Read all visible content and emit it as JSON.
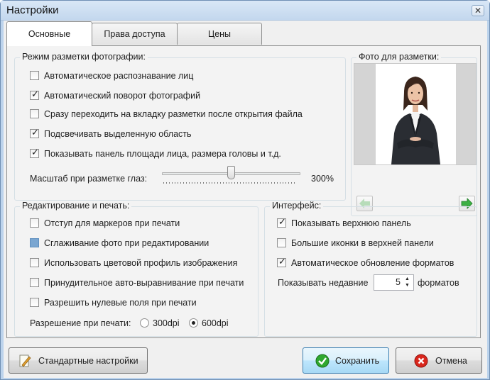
{
  "window": {
    "title": "Настройки",
    "close_label": "✕"
  },
  "tabs": [
    {
      "label": "Основные"
    },
    {
      "label": "Права доступа"
    },
    {
      "label": "Цены"
    }
  ],
  "markup_mode": {
    "title": "Режим разметки фотографии:",
    "options": [
      {
        "label": "Автоматическое распознавание лиц",
        "checked": false
      },
      {
        "label": "Автоматический поворот фотографий",
        "checked": true
      },
      {
        "label": "Сразу переходить на вкладку разметки после открытия файла",
        "checked": false
      },
      {
        "label": "Подсвечивать выделенную область",
        "checked": true
      },
      {
        "label": "Показывать панель площади лица, размера головы и т.д.",
        "checked": true
      }
    ],
    "eye_scale_label": "Масштаб при разметке глаз:",
    "eye_scale_value": "300%",
    "eye_scale_fraction": 0.5
  },
  "photo": {
    "title": "Фото для разметки:",
    "prev_icon": "arrow-left-icon",
    "next_icon": "arrow-right-icon"
  },
  "editing": {
    "title": "Редактирование и печать:",
    "options": [
      {
        "label": "Отступ для маркеров при печати",
        "checked": false
      },
      {
        "label": "Сглаживание фото при редактировании",
        "checked": "partial"
      },
      {
        "label": "Использовать цветовой профиль изображения",
        "checked": false
      },
      {
        "label": "Принудительное авто-выравнивание при печати",
        "checked": false
      },
      {
        "label": "Разрешить нулевые поля при печати",
        "checked": false
      }
    ],
    "resolution_label": "Разрешение при печати:",
    "resolution_options": [
      {
        "label": "300dpi",
        "selected": false
      },
      {
        "label": "600dpi",
        "selected": true
      }
    ]
  },
  "interface": {
    "title": "Интерфейс:",
    "options": [
      {
        "label": "Показывать верхнюю панель",
        "checked": true
      },
      {
        "label": "Большие иконки в верхней панели",
        "checked": false
      },
      {
        "label": "Автоматическое обновление форматов",
        "checked": true
      }
    ],
    "recent_label": "Показывать недавние",
    "recent_value": "5",
    "recent_suffix": "форматов"
  },
  "buttons": {
    "defaults": "Стандартные настройки",
    "save": "Сохранить",
    "cancel": "Отмена"
  },
  "colors": {
    "accent": "#3c7fb1",
    "save_icon": "#2fa82f",
    "cancel_icon": "#d9261c",
    "nav_arrow": "#3cb043"
  }
}
